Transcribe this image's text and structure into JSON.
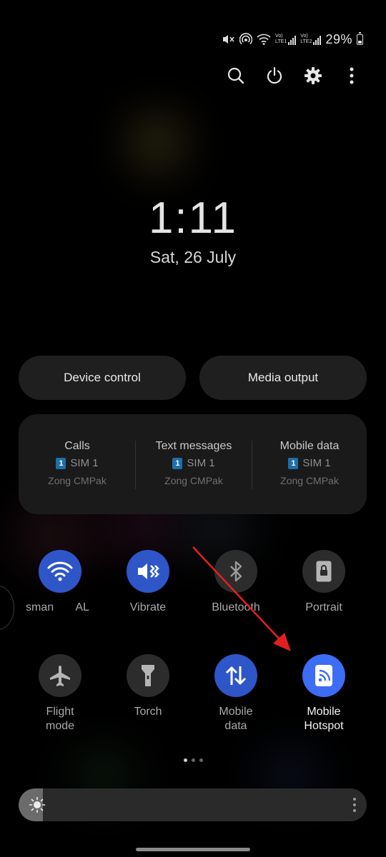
{
  "status_bar": {
    "lte1_label_top": "Vo)",
    "lte1_label_bottom": "LTE1",
    "lte2_label_top": "Vo)",
    "lte2_label_bottom": "LTE2",
    "battery_percent": "29%",
    "battery_level": 0.29
  },
  "top_actions": [
    "search-icon",
    "power-icon",
    "gear-icon",
    "more-vertical-icon"
  ],
  "clock": {
    "time": "1:11",
    "date": "Sat, 26 July"
  },
  "pills": {
    "device_control": "Device control",
    "media_output": "Media output"
  },
  "sim_card": [
    {
      "title": "Calls",
      "sim_number": "1",
      "sim_label": "SIM 1",
      "carrier": "Zong CMPak"
    },
    {
      "title": "Text messages",
      "sim_number": "1",
      "sim_label": "SIM 1",
      "carrier": "Zong CMPak"
    },
    {
      "title": "Mobile data",
      "sim_number": "1",
      "sim_label": "SIM 1",
      "carrier": "Zong CMPak"
    }
  ],
  "tiles": {
    "wifi": {
      "label": "sman       AL",
      "state": "on",
      "icon": "wifi-icon"
    },
    "vibrate": {
      "label": "Vibrate",
      "state": "on",
      "icon": "vibrate-icon"
    },
    "bluetooth": {
      "label": "Bluetooth",
      "state": "off",
      "icon": "bluetooth-icon"
    },
    "portrait": {
      "label": "Portrait",
      "state": "off",
      "icon": "portrait-lock-icon"
    },
    "flight": {
      "label_line1": "Flight",
      "label_line2": "mode",
      "state": "off",
      "icon": "airplane-icon"
    },
    "torch": {
      "label": "Torch",
      "state": "off",
      "icon": "flashlight-icon"
    },
    "mobile_data": {
      "label_line1": "Mobile",
      "label_line2": "data",
      "state": "on",
      "icon": "data-arrows-icon"
    },
    "hotspot": {
      "label_line1": "Mobile",
      "label_line2": "Hotspot",
      "state": "on",
      "icon": "hotspot-icon"
    }
  },
  "page_indicator": {
    "count": 3,
    "active": 0
  },
  "brightness": {
    "level": 0.07
  },
  "colors": {
    "accent_on": "#2e56c8",
    "hotspot_on": "#3d6cf5",
    "annotation_arrow": "#e0201e"
  }
}
